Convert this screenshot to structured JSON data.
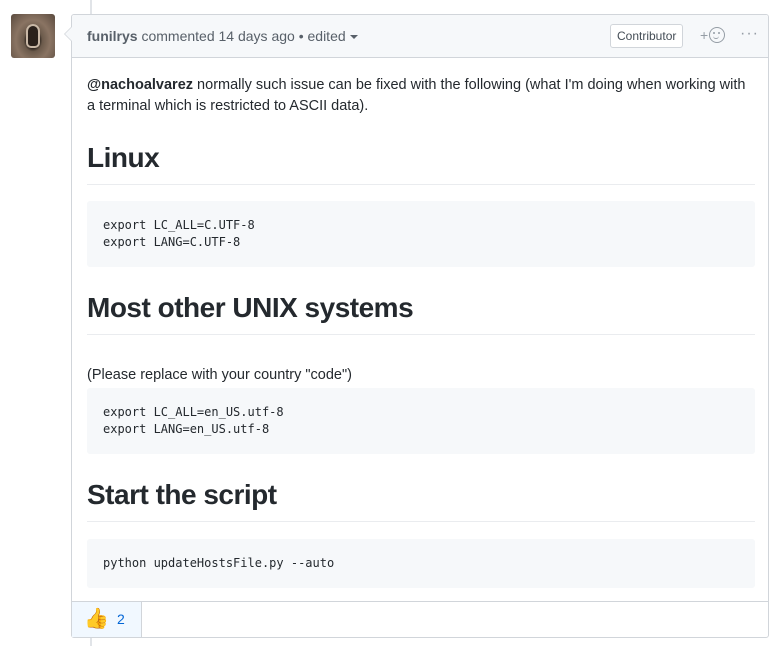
{
  "comment": {
    "author": "funilrys",
    "action": "commented",
    "time": "14 days ago",
    "separator": "•",
    "edited_label": "edited",
    "badge": "Contributor",
    "add_reaction_plus": "+",
    "more_label": "···",
    "intro": {
      "mention": "@nachoalvarez",
      "text": " normally such issue can be fixed with the following (what I'm doing when working with a terminal which is restricted to ASCII data)."
    },
    "sections": [
      {
        "title": "Linux",
        "code": "export LC_ALL=C.UTF-8\nexport LANG=C.UTF-8"
      },
      {
        "title": "Most other UNIX systems",
        "note": "(Please replace with your country \"code\")",
        "code": "export LC_ALL=en_US.utf-8\nexport LANG=en_US.utf-8"
      },
      {
        "title": "Start the script",
        "code": "python updateHostsFile.py --auto"
      }
    ],
    "reactions": [
      {
        "emoji": "👍",
        "icon": "thumbs-up-icon",
        "count": "2"
      }
    ]
  }
}
